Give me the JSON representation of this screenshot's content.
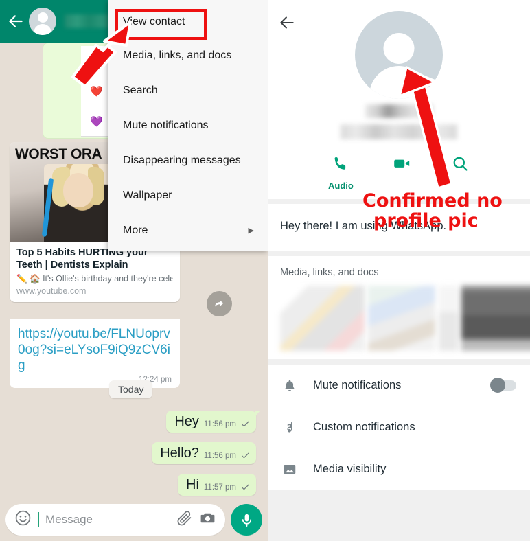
{
  "left_panel": {
    "header": {
      "back_icon": "back-arrow-icon",
      "avatar_icon": "default-avatar-icon",
      "contact_name": "",
      "name_redacted": true
    },
    "emoji_bubble": {
      "emojis": [
        "",
        "❤️",
        "💜"
      ]
    },
    "link_preview": {
      "thumb_overlay_text": "WORST ORA",
      "title": "Top 5 Habits HURTING your Teeth | Dentists Explain",
      "description": "✏️ 🏠 It's Ollie's birthday and they're celebr…",
      "domain": "www.youtube.com",
      "url": "https://youtu.be/FLNUoprv0og?si=eLYsoF9iQ9zCV6ig",
      "time": "12:24 pm",
      "play_icon": "play-icon",
      "forward_icon": "forward-icon"
    },
    "day_divider": "Today",
    "messages": [
      {
        "text": "Hey",
        "time": "11:56 pm",
        "status": "sent"
      },
      {
        "text": "Hello?",
        "time": "11:56 pm",
        "status": "sent"
      },
      {
        "text": "Hi",
        "time": "11:57 pm",
        "status": "sent"
      }
    ],
    "input_bar": {
      "emoji_icon": "emoji-icon",
      "placeholder": "Message",
      "attach_icon": "paperclip-icon",
      "camera_icon": "camera-icon",
      "mic_icon": "microphone-icon"
    },
    "popup_menu": {
      "items": [
        {
          "label": "View contact",
          "highlighted": true,
          "submenu": false
        },
        {
          "label": "Media, links, and docs",
          "highlighted": false,
          "submenu": false
        },
        {
          "label": "Search",
          "highlighted": false,
          "submenu": false
        },
        {
          "label": "Mute notifications",
          "highlighted": false,
          "submenu": false
        },
        {
          "label": "Disappearing messages",
          "highlighted": false,
          "submenu": false
        },
        {
          "label": "Wallpaper",
          "highlighted": false,
          "submenu": false
        },
        {
          "label": "More",
          "highlighted": false,
          "submenu": true
        }
      ],
      "submenu_chevron": "▶"
    }
  },
  "right_panel": {
    "back_icon": "back-arrow-icon",
    "overflow_icon": "more-vertical-icon",
    "avatar_icon": "default-avatar-icon",
    "contact_name": "",
    "phone_number": "",
    "name_redacted": true,
    "actions": [
      {
        "label": "Audio",
        "icon": "phone-icon"
      },
      {
        "label": "",
        "icon": "video-camera-icon"
      },
      {
        "label": "",
        "icon": "search-icon"
      }
    ],
    "about_text": "Hey there! I am using WhatsApp.",
    "media_section_title": "Media, links, and docs",
    "media_thumbs": 5,
    "rows": [
      {
        "label": "Mute notifications",
        "icon": "bell-icon",
        "toggle": true,
        "toggle_on": false
      },
      {
        "label": "Custom notifications",
        "icon": "music-note-icon",
        "toggle": false
      },
      {
        "label": "Media visibility",
        "icon": "image-icon",
        "toggle": false
      }
    ]
  },
  "annotations": {
    "callout_line1": "Confirmed no",
    "callout_line2": "profile pic",
    "callout_color": "#ee1111",
    "arrow_color": "#ee1111",
    "highlight_box_color": "#ee1111",
    "highlight_target": "View contact"
  },
  "colors": {
    "header_green": "#00866b",
    "chat_background": "#e6ded5",
    "outgoing_bubble": "#e2f7cd",
    "accent_green": "#00a884",
    "link_blue": "#2a9ec4",
    "action_green": "#008f6c"
  }
}
